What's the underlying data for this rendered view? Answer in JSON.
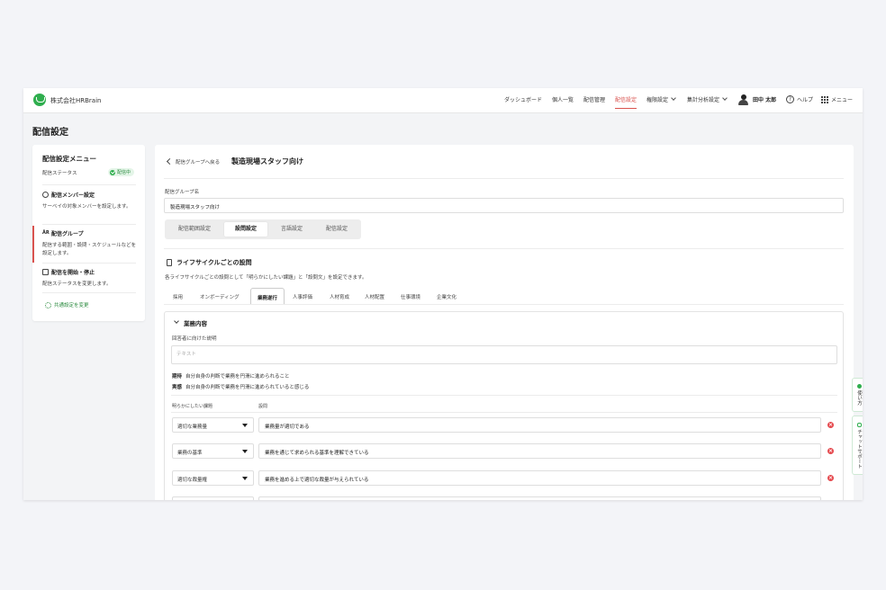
{
  "header": {
    "company": "株式会社HRBrain",
    "nav": [
      {
        "label": "ダッシュボード"
      },
      {
        "label": "個人一覧"
      },
      {
        "label": "配信管理"
      },
      {
        "label": "配信設定"
      },
      {
        "label": "権限設定"
      },
      {
        "label": "集計分析設定"
      }
    ],
    "user_name": "田中 太郎",
    "help_label": "ヘルプ",
    "menu_label": "メニュー"
  },
  "page_title": "配信設定",
  "left_menu": {
    "title": "配信設定メニュー",
    "status_label": "配信ステータス",
    "status_badge": "配信中",
    "items": [
      {
        "title": "配信メンバー設定",
        "desc": "サーベイの対象メンバーを設定します。"
      },
      {
        "title": "配信グループ",
        "desc": "配信する範囲・設問・スケジュールなどを設定します。"
      },
      {
        "title": "配信を開始・停止",
        "desc": "配信ステータスを変更します。"
      }
    ],
    "common_link": "共通設定を変更"
  },
  "main": {
    "back_label": "配信グループへ戻る",
    "group_title": "製造現場スタッフ向け",
    "group_name_label": "配信グループ名",
    "group_name_value": "製造現場スタッフ向け",
    "settings_tabs": [
      "配信範囲設定",
      "設問設定",
      "言語設定",
      "配信設定"
    ],
    "section_title": "ライフサイクルごとの設問",
    "section_desc": "各ライフサイクルごとの設問として「明らかにしたい課題」と「設問文」を設定できます。",
    "lifecycle_tabs": [
      "採用",
      "オンボーディング",
      "業務遂行",
      "人事評価",
      "人材育成",
      "人材配置",
      "仕事環境",
      "企業文化"
    ],
    "panel": {
      "title": "業務内容",
      "desc_label": "回答者に向けた説明",
      "desc_placeholder": "テキスト",
      "expectation_key": "期待",
      "expectation_text": "自分自身の判断で業務を円滑に進められること",
      "reality_key": "実感",
      "reality_text": "自分自身の判断で業務を円滑に進められていると感じる",
      "col_issue": "明らかにしたい課題",
      "col_question": "設問",
      "rows": [
        {
          "issue": "適切な業務量",
          "question": "業務量が適切である"
        },
        {
          "issue": "業務の基準",
          "question": "業務を通じて求められる基準を理解できている"
        },
        {
          "issue": "適切な裁量権",
          "question": "業務を進める上で適切な裁量が与えられている"
        }
      ]
    }
  },
  "side_tabs": {
    "usage": "使い方",
    "chat": "チャットサポート"
  }
}
